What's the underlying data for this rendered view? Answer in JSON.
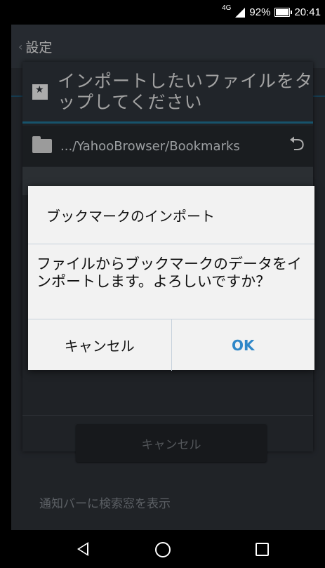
{
  "status_bar": {
    "network": "4G",
    "battery": "92%",
    "time": "20:41"
  },
  "settings": {
    "back_label": "設定",
    "notification_row": "通知バーに検索窓を表示"
  },
  "picker": {
    "title": "インポートしたいファイルをタップしてください",
    "path": ".../YahooBrowser/Bookmarks",
    "cancel_label": "キャンセル"
  },
  "modal": {
    "title": "ブックマークのインポート",
    "message": "ファイルからブックマークのデータをインポートします。よろしいですか？",
    "cancel_label": "キャンセル",
    "ok_label": "OK",
    "accent": "#2f87c8"
  }
}
